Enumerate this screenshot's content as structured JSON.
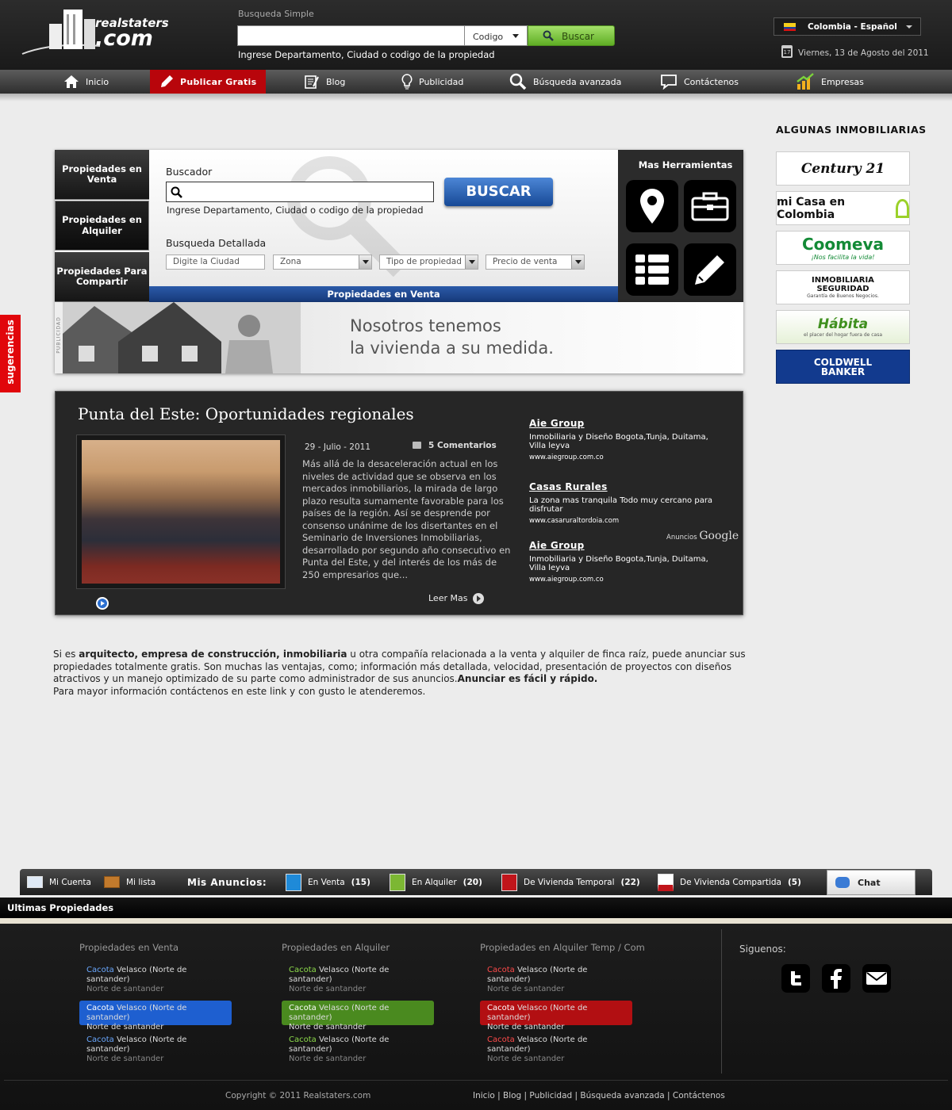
{
  "header": {
    "logo_top": "realstaters",
    "logo_bottom": ".com",
    "search_label": "Busqueda Simple",
    "search_value": "",
    "code_select": "Codigo",
    "search_button": "Buscar",
    "search_hint": "Ingrese Departamento, Ciudad o codigo de la propiedad",
    "language": "Colombia - Español",
    "date": "Viernes, 13 de Agosto del 2011"
  },
  "nav": [
    {
      "label": "Inicio",
      "icon": "home-icon"
    },
    {
      "label": "Publicar Gratis",
      "icon": "pencil-icon"
    },
    {
      "label": "Blog",
      "icon": "blog-icon"
    },
    {
      "label": "Publicidad",
      "icon": "lightbulb-icon"
    },
    {
      "label": "Búsqueda avanzada",
      "icon": "search-icon"
    },
    {
      "label": "Contáctenos",
      "icon": "speech-bubble-icon"
    },
    {
      "label": "Empresas",
      "icon": "growth-chart-icon"
    }
  ],
  "side_tab": "sugerencias",
  "widget": {
    "tabs": [
      "Propiedades en Venta",
      "Propiedades en Alquiler",
      "Propiedades Para Compartir"
    ],
    "buscador_label": "Buscador",
    "buscador_value": "",
    "hint": "Ingrese Departamento, Ciudad o codigo de la propiedad",
    "buscar_button": "BUSCAR",
    "detallada_label": "Busqueda Detallada",
    "filters": [
      "Digite la Ciudad",
      "Zona",
      "Tipo de propiedad",
      "Precio de venta"
    ],
    "bar_label": "Propiedades en Venta",
    "tools_title": "Mas Herramientas",
    "tools": [
      "map-pin-icon",
      "briefcase-icon",
      "list-icon",
      "edit-icon"
    ]
  },
  "banner": {
    "side_label": "PUBLICIDAD",
    "line1": "Nosotros tenemos",
    "line2": "la vivienda a su medida."
  },
  "news": {
    "title": "Punta del Este: Oportunidades regionales",
    "date": "29 - Julio - 2011",
    "comments": "5 Comentarios",
    "body": "Más allá de la desaceleración actual en los niveles de actividad que se observa en los mercados inmobiliarios, la mirada de largo plazo resulta sumamente favorable para los países de la región. Así se desprende por consenso unánime de los disertantes en el Seminario de Inversiones Inmobiliarias, desarrollado por segundo año consecutivo en Punta del Este, y del interés de los más de 250 empresarios que...",
    "read_more": "Leer Mas",
    "ads": [
      {
        "title": "Aie Group",
        "desc": "Inmobiliaria y Diseño Bogota,Tunja, Duitama, Villa leyva",
        "url": "www.aiegroup.com.co"
      },
      {
        "title": "Casas Rurales",
        "desc": "La zona mas tranquila Todo muy cercano para disfrutar",
        "url": "www.casaruraltordoia.com"
      },
      {
        "title": "Aie Group",
        "desc": "Inmobiliaria y Diseño Bogota,Tunja, Duitama, Villa leyva",
        "url": "www.aiegroup.com.co"
      }
    ],
    "ads_label": "Anuncios",
    "ads_brand": "Google"
  },
  "info": {
    "p1_a": "Si es ",
    "p1_b": "arquitecto, empresa de construcción, inmobiliaria",
    "p1_c": " u otra compañía relacionada a la venta y alquiler de finca raíz, puede anunciar sus propiedades totalmente gratis. Son muchas las ventajas, como; información más detallada, velocidad, presentación de proyectos con diseños atractivos y un manejo optimizado de su parte como administrador de sus anuncios.",
    "p1_d": "Anunciar es fácil y rápido.",
    "p2": "Para mayor información contáctenos en este link y con gusto le atenderemos."
  },
  "sidebar": {
    "title": "ALGUNAS INMOBILIARIAS",
    "logos": [
      "Century 21",
      "mi Casa en Colombia",
      "Coomeva",
      "INMOBILIARIA SEGURIDAD",
      "Hábita",
      "COLDWELL BANKER"
    ],
    "logo_tags": [
      "",
      "",
      "¡Nos facilita la vida!",
      "Garantía de Buenos Negocios.",
      "el placer del hogar fuera de casa",
      ""
    ]
  },
  "bottom_bar": {
    "mi_cuenta": "Mi Cuenta",
    "mi_lista": "Mi lista",
    "mis_anuncios": "Mis Anuncios:",
    "items": [
      {
        "label": "En Venta",
        "count": "(15)",
        "color": "#1f8ad8"
      },
      {
        "label": "En Alquiler",
        "count": "(20)",
        "color": "#7cb733"
      },
      {
        "label": "De Vivienda Temporal",
        "count": "(22)",
        "color": "#c1151b"
      },
      {
        "label": "De Vivienda Compartida",
        "count": "(5)",
        "color": "#c1151b"
      }
    ],
    "chat": "Chat"
  },
  "ultimas": "Ultimas Propiedades",
  "footer": {
    "columns": [
      {
        "title": "Propiedades en Venta",
        "accent": "#6aa8ff",
        "hl": "#1e5fd0"
      },
      {
        "title": "Propiedades en Alquiler",
        "accent": "#8ddb4b",
        "hl": "#4a8a1f"
      },
      {
        "title": "Propiedades en Alquiler Temp / Com",
        "accent": "#ff4a4a",
        "hl": "#b20f12"
      }
    ],
    "entry_city": "Cacota",
    "entry_rest": " Velasco (Norte de santander)",
    "entry_sub": "Norte de santander",
    "siguenos": "Siguenos:",
    "social": [
      "twitter-icon",
      "facebook-icon",
      "email-icon"
    ],
    "copyright": "Copyright ©  2011 Realstaters.com",
    "links": "Inicio | Blog | Publicidad | Búsqueda avanzada | Contáctenos"
  }
}
